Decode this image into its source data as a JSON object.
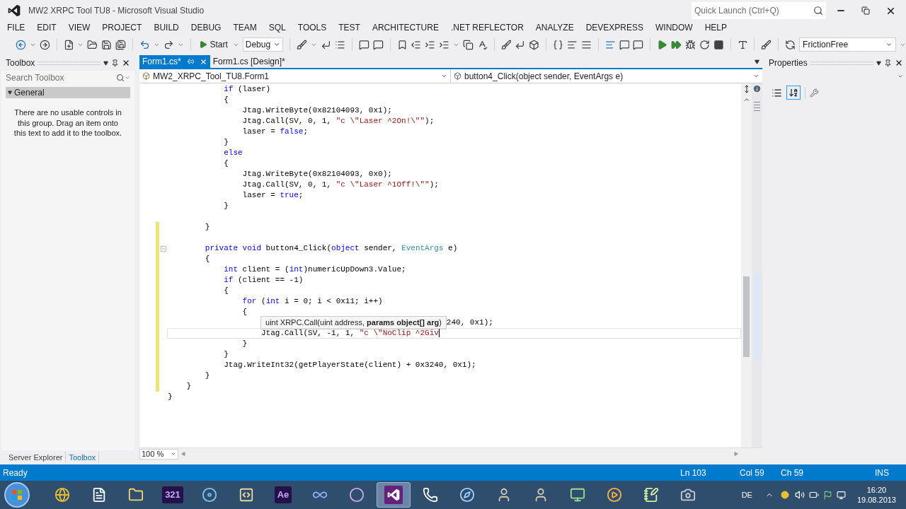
{
  "window": {
    "title": "MW2 XRPC Tool TU8 - Microsoft Visual Studio",
    "quick_launch": {
      "placeholder": "Quick Launch (Ctrl+Q)"
    }
  },
  "menu": [
    "FILE",
    "EDIT",
    "VIEW",
    "PROJECT",
    "BUILD",
    "DEBUG",
    "TEAM",
    "SQL",
    "TOOLS",
    "TEST",
    "ARCHITECTURE",
    ".NET REFLECTOR",
    "ANALYZE",
    "DEVEXPRESS",
    "WINDOW",
    "HELP"
  ],
  "toolbar": {
    "start": "Start",
    "configuration": "Debug",
    "profile": "FrictionFree"
  },
  "toolbox": {
    "title": "Toolbox",
    "search": {
      "placeholder": "Search Toolbox"
    },
    "group": {
      "label": "General",
      "expanded": true
    },
    "message": "There are no usable controls in this group. Drag an item onto this text to add it to the toolbox."
  },
  "editor": {
    "tabs": [
      {
        "label": "Form1.cs*",
        "selected": true
      },
      {
        "label": "Form1.cs [Design]*",
        "selected": false
      }
    ],
    "class_nav": "MW2_XRPC_Tool_TU8.Form1",
    "member_nav": "button4_Click(object sender, EventArgs e)",
    "code": [
      {
        "children": [
          {
            "children": [
              {
                "children": [
                  {
                    "changed": false,
                    "segments": [
                      {
                        "kind": "keyword",
                        "text": "if"
                      },
                      {
                        "kind": "plain",
                        "text": " (laser)"
                      }
                    ]
                  },
                  {
                    "changed": false,
                    "segments": [
                      {
                        "kind": "plain",
                        "text": "{"
                      }
                    ]
                  },
                  {
                    "children": [
                      {
                        "changed": false,
                        "segments": [
                          {
                            "kind": "plain",
                            "text": "Jtag.WriteByte(0x82104093, 0x1);"
                          }
                        ]
                      },
                      {
                        "changed": false,
                        "segments": [
                          {
                            "kind": "plain",
                            "text": "Jtag.Call(SV, 0, 1, "
                          },
                          {
                            "kind": "string",
                            "text": "\"c \\\"Laser ^2On!\\\"\""
                          },
                          {
                            "kind": "plain",
                            "text": ");"
                          }
                        ]
                      },
                      {
                        "changed": false,
                        "segments": [
                          {
                            "kind": "plain",
                            "text": "laser = "
                          },
                          {
                            "kind": "keyword",
                            "text": "false"
                          },
                          {
                            "kind": "plain",
                            "text": ";"
                          }
                        ]
                      }
                    ]
                  },
                  {
                    "changed": false,
                    "segments": [
                      {
                        "kind": "plain",
                        "text": "}"
                      }
                    ]
                  },
                  {
                    "changed": false,
                    "segments": [
                      {
                        "kind": "keyword",
                        "text": "else"
                      }
                    ]
                  },
                  {
                    "changed": false,
                    "segments": [
                      {
                        "kind": "plain",
                        "text": "{"
                      }
                    ]
                  },
                  {
                    "children": [
                      {
                        "changed": false,
                        "segments": [
                          {
                            "kind": "plain",
                            "text": "Jtag.WriteByte(0x82104093, 0x0);"
                          }
                        ]
                      },
                      {
                        "changed": false,
                        "segments": [
                          {
                            "kind": "plain",
                            "text": "Jtag.Call(SV, 0, 1, "
                          },
                          {
                            "kind": "string",
                            "text": "\"c \\\"Laser ^1Off!\\\"\""
                          },
                          {
                            "kind": "plain",
                            "text": ");"
                          }
                        ]
                      },
                      {
                        "changed": false,
                        "segments": [
                          {
                            "kind": "plain",
                            "text": "laser = "
                          },
                          {
                            "kind": "keyword",
                            "text": "true"
                          },
                          {
                            "kind": "plain",
                            "text": ";"
                          }
                        ]
                      }
                    ]
                  },
                  {
                    "changed": false,
                    "segments": [
                      {
                        "kind": "plain",
                        "text": "}"
                      }
                    ]
                  }
                ]
              },
              {
                "changed": false
              },
              {
                "changed": true,
                "segments": [
                  {
                    "kind": "plain",
                    "text": "}"
                  }
                ]
              },
              {
                "changed": true
              },
              {
                "changed": true,
                "collapsible": true,
                "segments": [
                  {
                    "kind": "keyword",
                    "text": "private void"
                  },
                  {
                    "kind": "plain",
                    "text": " button4_Click("
                  },
                  {
                    "kind": "keyword",
                    "text": "object"
                  },
                  {
                    "kind": "plain",
                    "text": " sender, "
                  },
                  {
                    "kind": "type",
                    "text": "EventArgs"
                  },
                  {
                    "kind": "plain",
                    "text": " e)"
                  }
                ]
              },
              {
                "changed": true,
                "segments": [
                  {
                    "kind": "plain",
                    "text": "{"
                  }
                ]
              },
              {
                "children": [
                  {
                    "changed": true,
                    "segments": [
                      {
                        "kind": "keyword",
                        "text": "int"
                      },
                      {
                        "kind": "plain",
                        "text": " client = ("
                      },
                      {
                        "kind": "keyword",
                        "text": "int"
                      },
                      {
                        "kind": "plain",
                        "text": ")numericUpDown3.Value;"
                      }
                    ]
                  },
                  {
                    "changed": true,
                    "segments": [
                      {
                        "kind": "keyword",
                        "text": "if"
                      },
                      {
                        "kind": "plain",
                        "text": " (client == -1)"
                      }
                    ]
                  },
                  {
                    "changed": true,
                    "segments": [
                      {
                        "kind": "plain",
                        "text": "{"
                      }
                    ]
                  },
                  {
                    "children": [
                      {
                        "changed": true,
                        "segments": [
                          {
                            "kind": "keyword",
                            "text": "for"
                          },
                          {
                            "kind": "plain",
                            "text": " ("
                          },
                          {
                            "kind": "keyword",
                            "text": "int"
                          },
                          {
                            "kind": "plain",
                            "text": " i = 0; i < 0x11; i++)"
                          }
                        ]
                      },
                      {
                        "changed": true,
                        "segments": [
                          {
                            "kind": "plain",
                            "text": "{"
                          }
                        ]
                      },
                      {
                        "children": [
                          {
                            "changed": true,
                            "tooltip": "uint XRPC.Call(uint address, **params object[] arg**)",
                            "segments": [
                              {
                                "kind": "plain",
                                "text": "240, 0x1);"
                              }
                            ]
                          },
                          {
                            "changed": true,
                            "current": true,
                            "segments": [
                              {
                                "kind": "plain",
                                "text": "Jtag.Call(SV, -1, 1, "
                              },
                              {
                                "kind": "string",
                                "text": "\"c \\\"NoClip ^2Giv"
                              }
                            ]
                          }
                        ]
                      },
                      {
                        "changed": true,
                        "segments": [
                          {
                            "kind": "plain",
                            "text": "}"
                          }
                        ]
                      }
                    ]
                  },
                  {
                    "changed": true,
                    "segments": [
                      {
                        "kind": "plain",
                        "text": "}"
                      }
                    ]
                  },
                  {
                    "changed": true,
                    "segments": [
                      {
                        "kind": "plain",
                        "text": "Jtag.WriteInt32(getPlayerState(client) + 0x3240, 0x1);"
                      }
                    ]
                  }
                ]
              },
              {
                "changed": true,
                "segments": [
                  {
                    "kind": "plain",
                    "text": "}"
                  }
                ]
              }
            ]
          },
          {
            "changed": true,
            "segments": [
              {
                "kind": "plain",
                "text": "}"
              }
            ]
          }
        ]
      },
      {
        "changed": false,
        "segments": [
          {
            "kind": "plain",
            "text": "}"
          }
        ]
      }
    ],
    "zoom": "100 %"
  },
  "properties": {
    "title": "Properties"
  },
  "bottom_tabs": [
    {
      "label": "Server Explorer",
      "selected": false
    },
    {
      "label": "Toolbox",
      "selected": true
    }
  ],
  "status_bar": {
    "status": "Ready",
    "line": "Ln 103",
    "column": "Col 59",
    "char": "Ch 59",
    "mode": "INS"
  },
  "taskbar": {
    "items": [
      {
        "kind": "browser",
        "selected": false
      },
      {
        "kind": "document",
        "selected": false
      },
      {
        "kind": "folder",
        "selected": false
      },
      {
        "kind": "label",
        "label": "321",
        "selected": false
      },
      {
        "kind": "disc",
        "selected": false
      },
      {
        "kind": "hex",
        "selected": false
      },
      {
        "kind": "label",
        "label": "Ae",
        "selected": false
      },
      {
        "kind": "infinity",
        "selected": false
      },
      {
        "kind": "sphere",
        "selected": false
      },
      {
        "kind": "studio",
        "selected": true
      },
      {
        "kind": "phone",
        "selected": false
      },
      {
        "kind": "compass",
        "selected": false
      },
      {
        "kind": "portrait",
        "selected": false
      },
      {
        "kind": "portrait",
        "selected": false
      },
      {
        "kind": "monitor",
        "selected": false
      },
      {
        "kind": "player",
        "selected": false
      },
      {
        "kind": "notepad",
        "selected": false
      },
      {
        "kind": "camera",
        "selected": false
      }
    ],
    "language": "DE",
    "time": "16:20",
    "date": "19.08.2013"
  }
}
